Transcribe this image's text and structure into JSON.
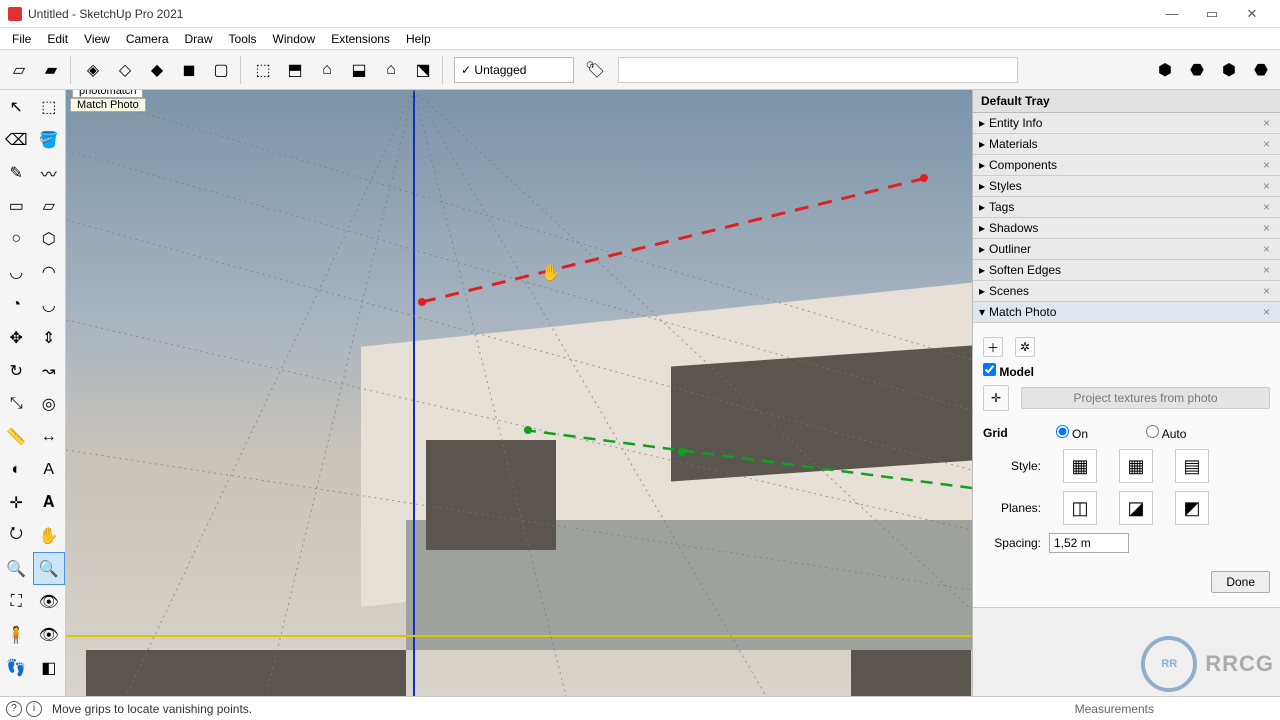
{
  "window": {
    "title": "Untitled - SketchUp Pro 2021"
  },
  "menu": [
    "File",
    "Edit",
    "View",
    "Camera",
    "Draw",
    "Tools",
    "Window",
    "Extensions",
    "Help"
  ],
  "tag_dropdown": {
    "selected": "Untagged",
    "check": "✓"
  },
  "scene_tab": {
    "name": "photomatch",
    "badge": "Match Photo"
  },
  "tray": {
    "title": "Default Tray",
    "collapsed_panels": [
      "Entity Info",
      "Materials",
      "Components",
      "Styles",
      "Tags",
      "Shadows",
      "Outliner",
      "Soften Edges",
      "Scenes"
    ],
    "active_panel": "Match Photo",
    "match_photo": {
      "model_checkbox_label": "Model",
      "model_checked": true,
      "project_button": "Project textures from photo",
      "grid_label": "Grid",
      "grid_on_label": "On",
      "grid_auto_label": "Auto",
      "grid_mode": "On",
      "style_label": "Style:",
      "planes_label": "Planes:",
      "spacing_label": "Spacing:",
      "spacing_value": "1,52 m",
      "done_label": "Done"
    }
  },
  "status": {
    "hint": "Move grips to locate vanishing points.",
    "measurements_label": "Measurements"
  },
  "watermark": {
    "text": "RRCG"
  }
}
